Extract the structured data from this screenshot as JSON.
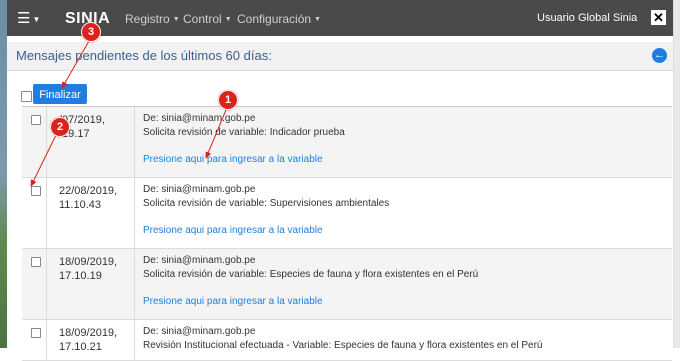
{
  "navbar": {
    "menu_icon": "hamburger-icon",
    "brand": "SINIA",
    "links": [
      "Registro",
      "Control",
      "Configuración"
    ],
    "user": "Usuario Global Sinia",
    "close_icon": "close-icon"
  },
  "header": {
    "title": "Mensajes pendientes de los últimos 60 días:",
    "back_icon": "arrow-left-circle-icon"
  },
  "toolbar": {
    "finalize_label": "Finalizar"
  },
  "messages": [
    {
      "date": "/07/2019,",
      "time": ".19.17",
      "from": "De: sinia@minam.gob.pe",
      "subject": "Solicita revisión de variable: Indicador prueba",
      "link": "Presione aqui para ingresar a la variable"
    },
    {
      "date": "22/08/2019,",
      "time": "11.10.43",
      "from": "De: sinia@minam.gob.pe",
      "subject": "Solicita revisión de variable: Supervisiones ambientales",
      "link": "Presione aqui para ingresar a la variable"
    },
    {
      "date": "18/09/2019,",
      "time": "17.10.19",
      "from": "De: sinia@minam.gob.pe",
      "subject": "Solicita revisión de variable: Especies de fauna y flora existentes en el Perú",
      "link": "Presione aqui para ingresar a la variable"
    },
    {
      "date": "18/09/2019,",
      "time": "17.10.21",
      "from": "De: sinia@minam.gob.pe",
      "subject": "Revisión Institucional efectuada - Variable: Especies de fauna y flora existentes en el Perú",
      "link": ""
    }
  ],
  "annotations": [
    "1",
    "2",
    "3"
  ],
  "colors": {
    "navbar": "#4a4a4a",
    "accent": "#1f7fe0",
    "marker": "#d9231c"
  }
}
